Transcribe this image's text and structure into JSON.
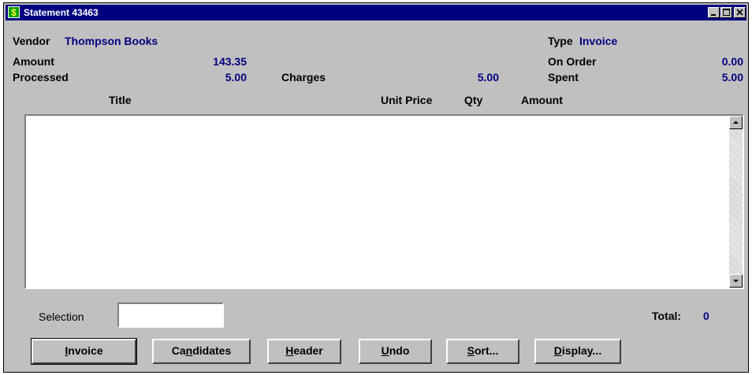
{
  "window": {
    "title": "Statement 43463",
    "app_icon": "$"
  },
  "header": {
    "vendor_label": "Vendor",
    "vendor_value": "Thompson Books",
    "type_label": "Type",
    "type_value": "Invoice",
    "amount_label": "Amount",
    "amount_value": "143.35",
    "on_order_label": "On Order",
    "on_order_value": "0.00",
    "processed_label": "Processed",
    "processed_value": "5.00",
    "charges_label": "Charges",
    "charges_value": "5.00",
    "spent_label": "Spent",
    "spent_value": "5.00"
  },
  "columns": {
    "title": "Title",
    "unit_price": "Unit Price",
    "qty": "Qty",
    "amount": "Amount"
  },
  "footer": {
    "selection_label": "Selection",
    "selection_value": "",
    "total_label": "Total:",
    "total_value": "0"
  },
  "buttons": [
    {
      "pre": "",
      "key": "I",
      "post": "nvoice"
    },
    {
      "pre": "Ca",
      "key": "n",
      "post": "didates"
    },
    {
      "pre": "",
      "key": "H",
      "post": "eader"
    },
    {
      "pre": "",
      "key": "U",
      "post": "ndo"
    },
    {
      "pre": "",
      "key": "S",
      "post": "ort..."
    },
    {
      "pre": "",
      "key": "D",
      "post": "isplay..."
    }
  ],
  "colors": {
    "title_bar": "#000080",
    "value_text": "#000080",
    "face": "#c0c0c0"
  }
}
